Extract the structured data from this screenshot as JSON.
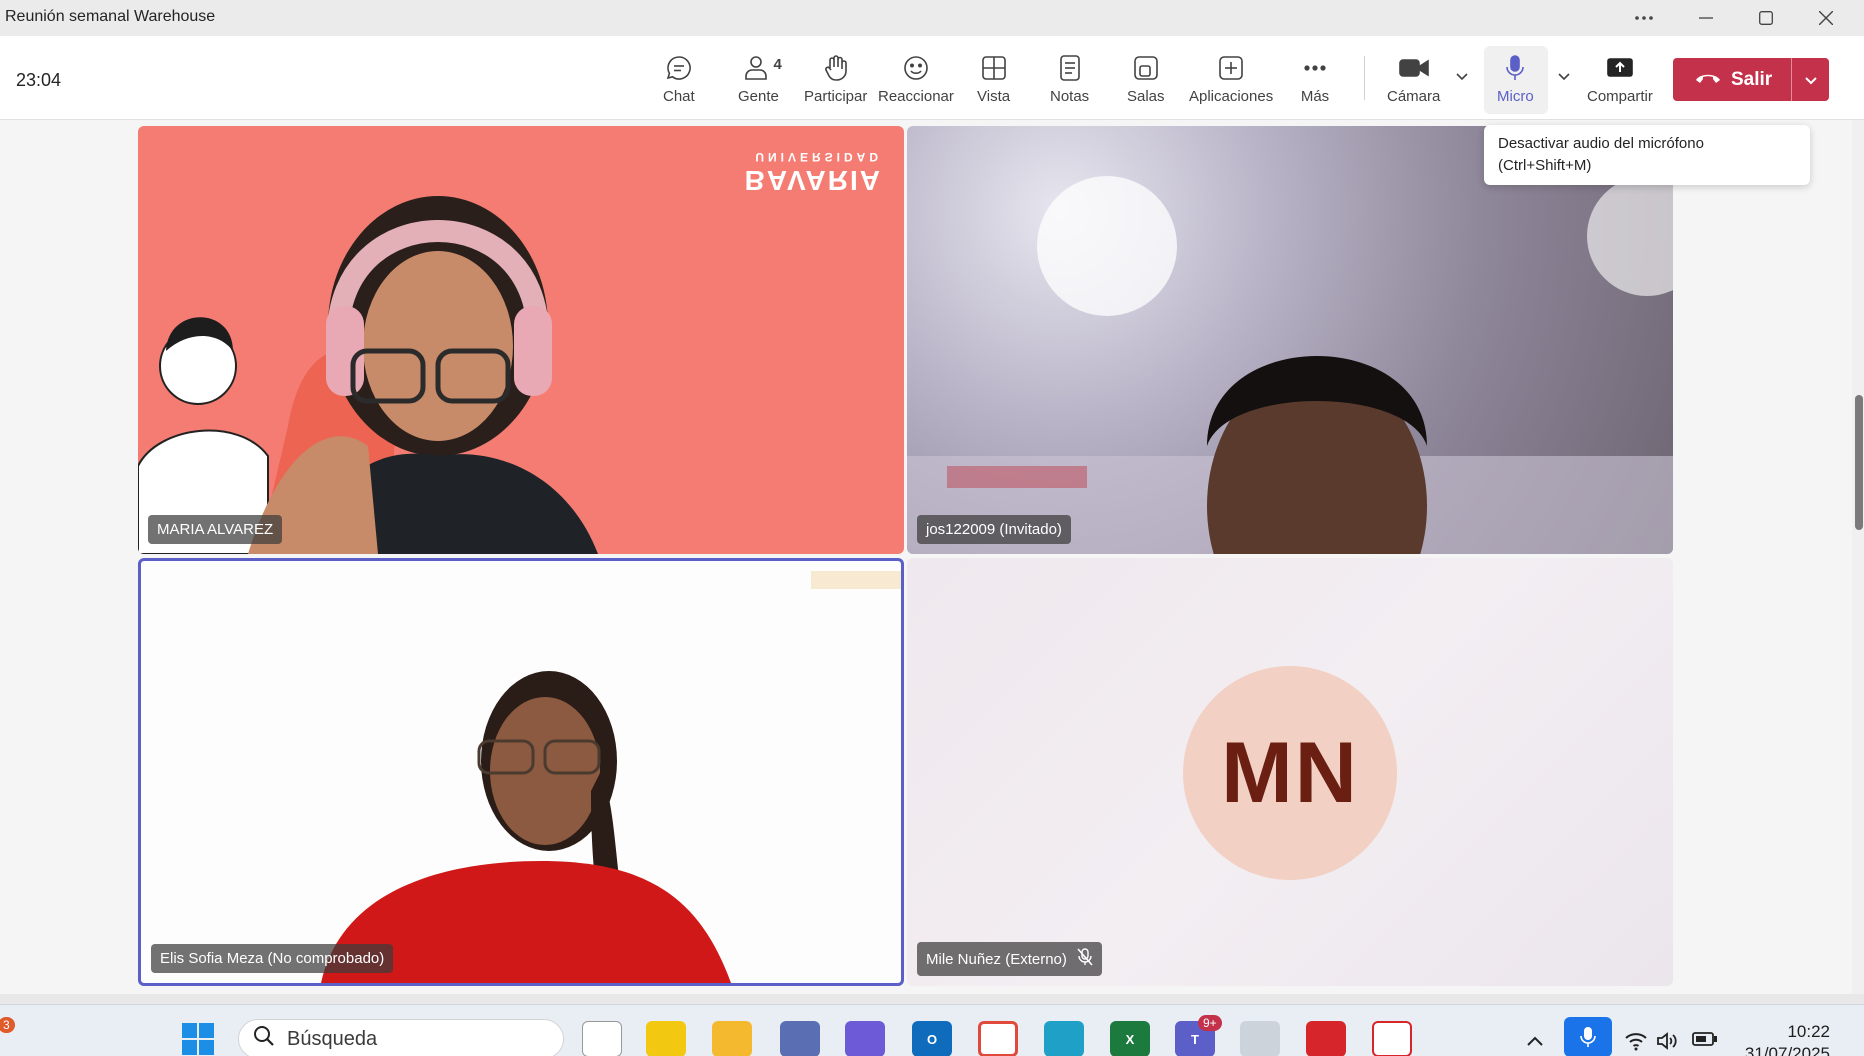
{
  "window": {
    "title": "Reunión semanal Warehouse"
  },
  "meeting": {
    "timer": "23:04"
  },
  "toolbar": {
    "chat": "Chat",
    "people": "Gente",
    "people_count": "4",
    "raise_hand": "Participar",
    "react": "Reaccionar",
    "view": "Vista",
    "notes": "Notas",
    "rooms": "Salas",
    "apps": "Aplicaciones",
    "more": "Más",
    "camera": "Cámara",
    "mic": "Micro",
    "share": "Compartir",
    "leave": "Salir"
  },
  "tooltip": {
    "line1": "Desactivar audio del micrófono",
    "line2": "(Ctrl+Shift+M)"
  },
  "participants": [
    {
      "name": "MARIA ALVAREZ",
      "muted": false
    },
    {
      "name": "jos122009 (Invitado)",
      "muted": false
    },
    {
      "name": "Elis Sofia Meza (No comprobado)",
      "muted": false,
      "active": true
    },
    {
      "name": "Mile Nuñez (Externo)",
      "muted": true,
      "initials": "MN"
    }
  ],
  "branding": {
    "logo_line1": "UNIVERSIDAD",
    "logo_line2": "BAVARIA"
  },
  "taskbar": {
    "search_placeholder": "Búsqueda",
    "teams_badge": "9+",
    "notification_count": "3",
    "time": "10:22",
    "date": "31/07/2025"
  },
  "colors": {
    "accent": "#5b5fc7",
    "leave": "#c4314b",
    "tile1_bg": "#f47c72",
    "avatar_bg": "#f2d1c4",
    "avatar_text": "#6b1e12"
  }
}
